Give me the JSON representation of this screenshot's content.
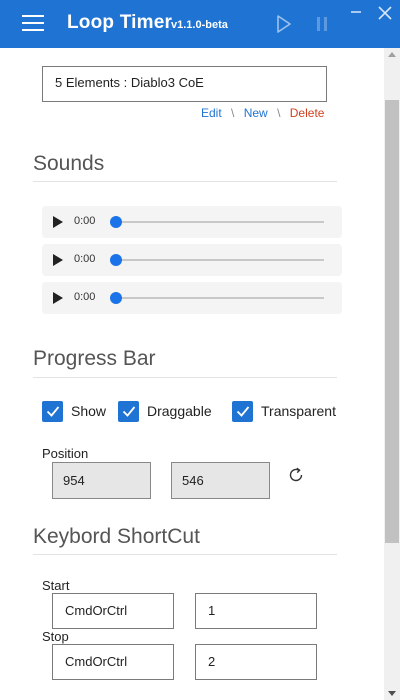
{
  "titlebar": {
    "title": "Loop Timer",
    "version": "v1.1.0-beta"
  },
  "profile": {
    "value": "5 Elements : Diablo3 CoE",
    "links": {
      "edit": "Edit",
      "new": "New",
      "delete": "Delete",
      "separator": "\\"
    }
  },
  "sounds": {
    "title": "Sounds",
    "players": [
      {
        "time": "0:00"
      },
      {
        "time": "0:00"
      },
      {
        "time": "0:00"
      }
    ]
  },
  "progress_bar": {
    "title": "Progress Bar",
    "options": [
      {
        "label": "Show",
        "checked": true
      },
      {
        "label": "Draggable",
        "checked": true
      },
      {
        "label": "Transparent",
        "checked": true
      }
    ],
    "position_label": "Position",
    "position_x": "954",
    "position_y": "546"
  },
  "shortcuts": {
    "title": "Keybord ShortCut",
    "start_label": "Start",
    "start_modifier": "CmdOrCtrl",
    "start_key": "1",
    "stop_label": "Stop",
    "stop_modifier": "CmdOrCtrl",
    "stop_key": "2"
  },
  "colors": {
    "accent": "#1f74d3",
    "delete": "#d04020",
    "slider_knob": "#1a73e8"
  },
  "icons": {
    "menu": "hamburger-icon",
    "play": "play-icon",
    "pause": "pause-icon",
    "minimize": "minimize-icon",
    "close": "close-icon",
    "refresh": "refresh-icon",
    "check": "checkmark-icon"
  }
}
